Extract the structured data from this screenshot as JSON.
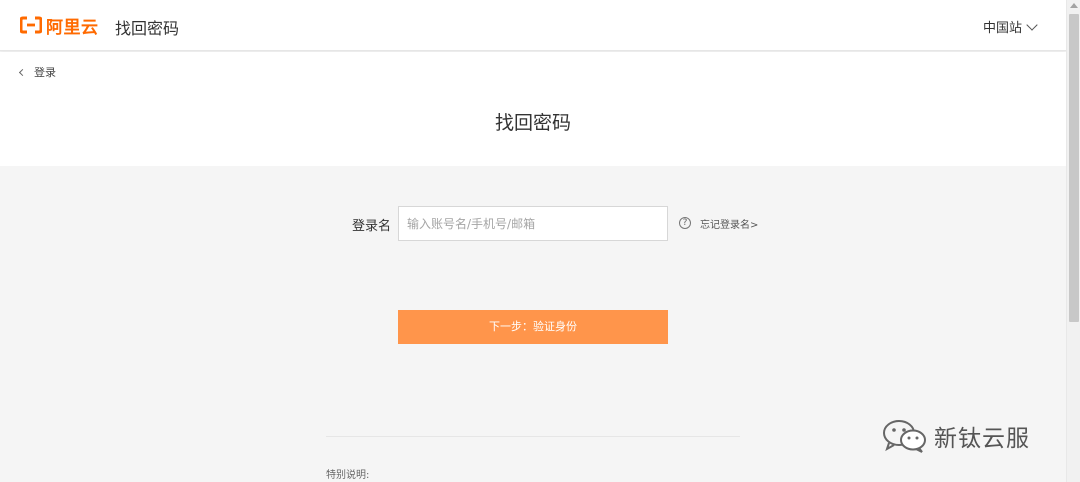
{
  "header": {
    "logo_text": "阿里云",
    "logo_icon": "aliyun-logo-icon",
    "title": "找回密码",
    "region_label": "中国站",
    "region_icon": "chevron-down-icon"
  },
  "nav": {
    "back_label": "登录",
    "back_icon": "chevron-left-icon"
  },
  "page": {
    "title": "找回密码"
  },
  "form": {
    "login_name_label": "登录名",
    "login_name_value": "",
    "login_name_placeholder": "输入账号名/手机号/邮箱",
    "help_icon": "question-circle-icon",
    "help_glyph": "?",
    "forgot_login_name": "忘记登录名>",
    "next_button": "下一步：验证身份"
  },
  "footer": {
    "note_title": "特别说明:"
  },
  "watermark": {
    "text": "新钛云服",
    "icon": "wechat-icon"
  },
  "colors": {
    "brand": "#ff6a00",
    "button": "#ff954b",
    "background": "#f5f5f5"
  }
}
